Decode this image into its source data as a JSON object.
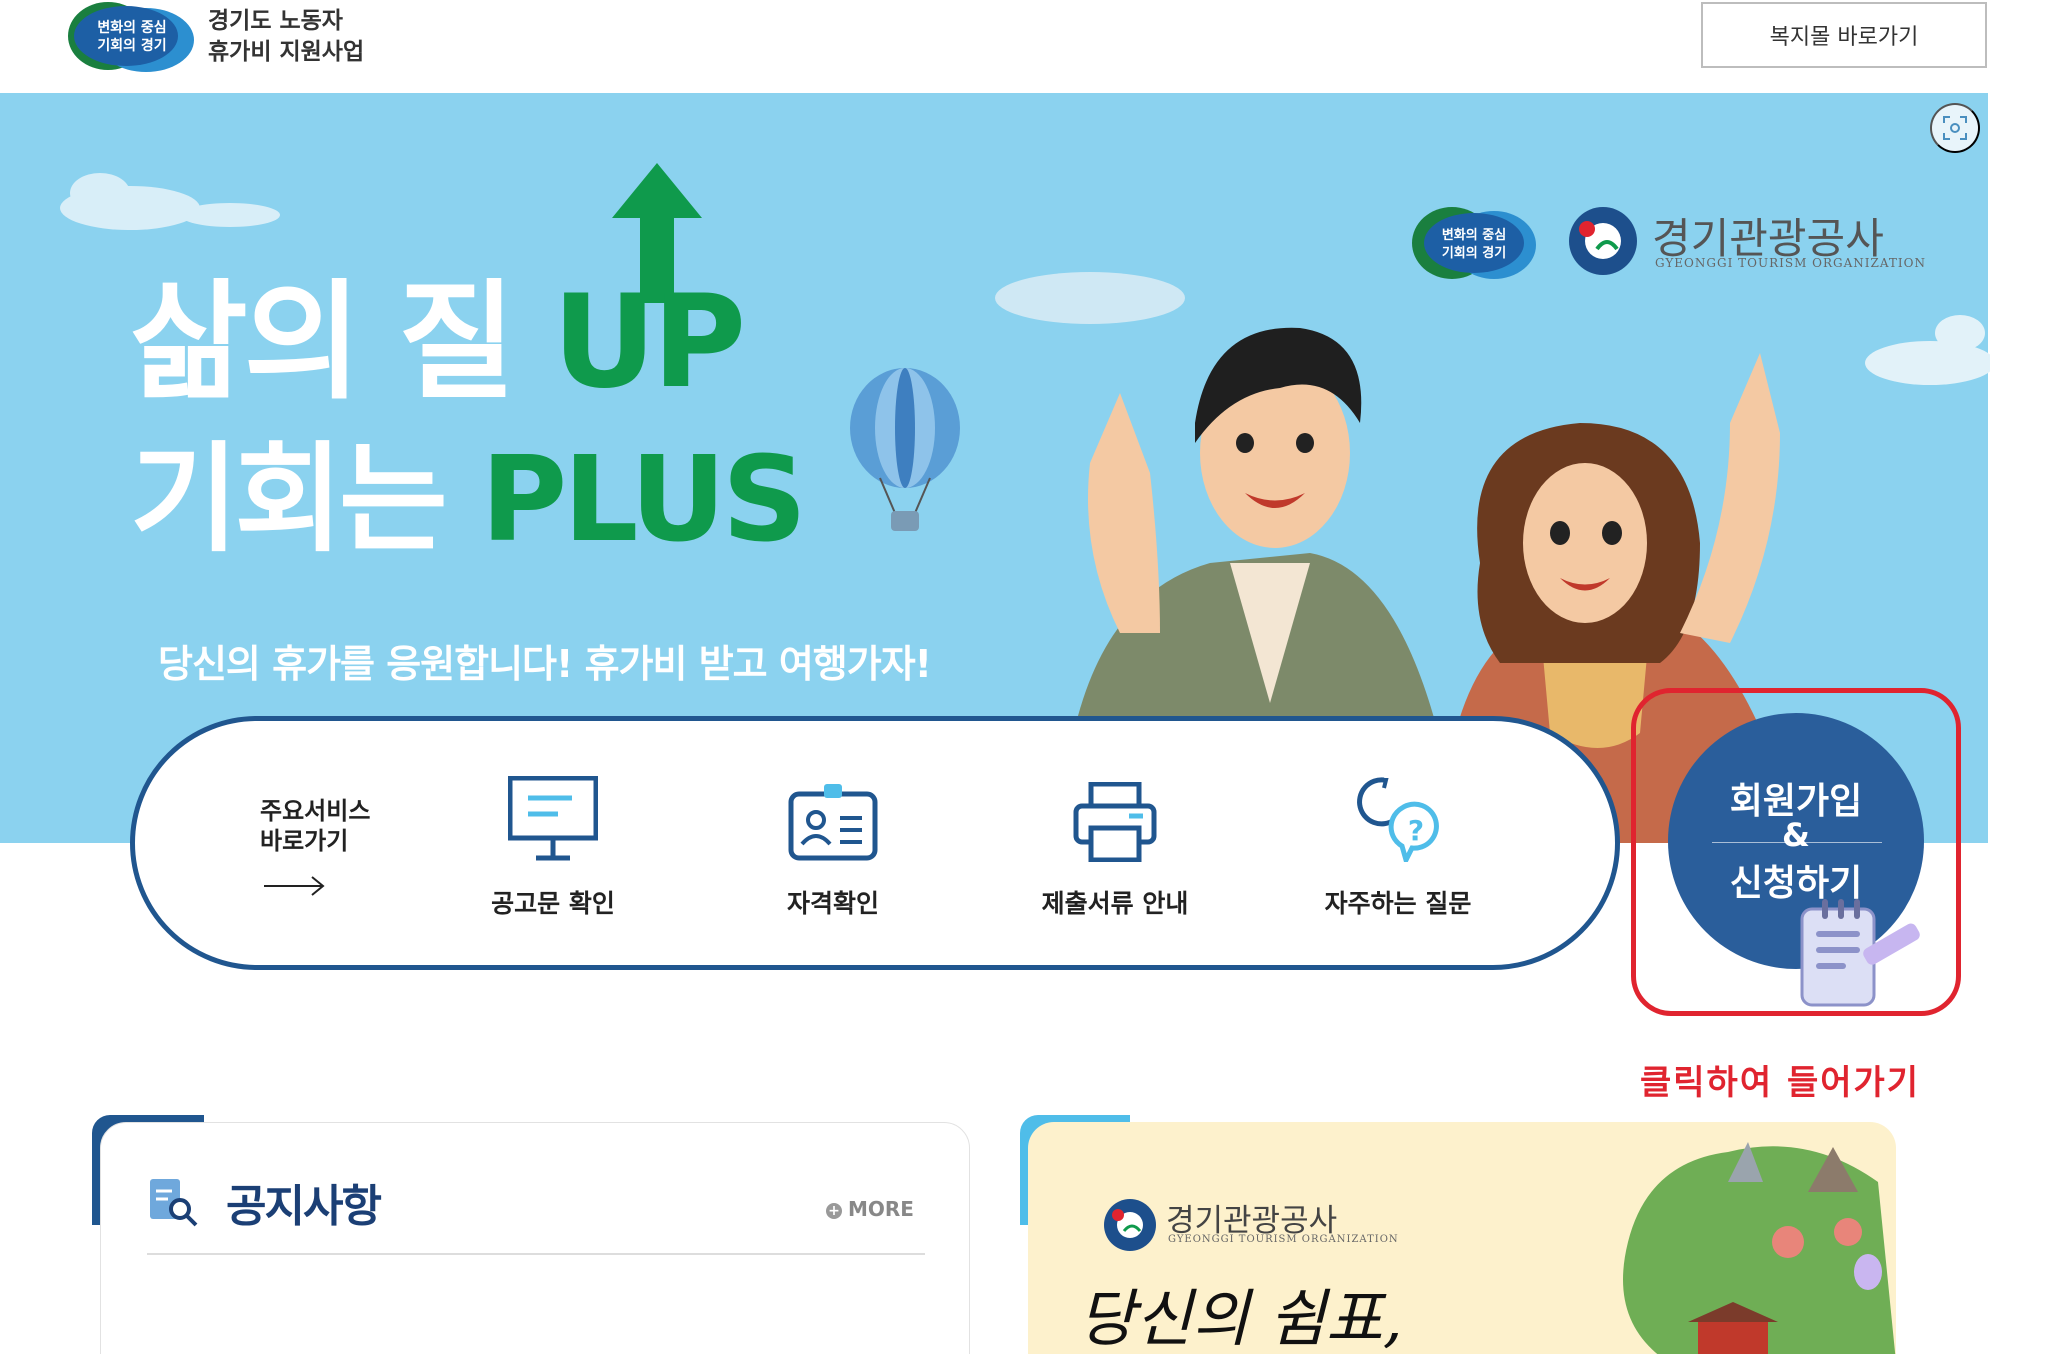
{
  "header": {
    "logo_badge_line1": "변화의 중심",
    "logo_badge_line2": "기회의 경기",
    "title_line1": "경기도 노동자",
    "title_line2": "휴가비 지원사업",
    "mall_button": "복지몰 바로가기"
  },
  "hero": {
    "title_line1_white": "삶의 질 ",
    "title_line1_green": "UP",
    "title_line2_white": "기회는 ",
    "title_line2_green": "PLUS",
    "subtitle": "당신의 휴가를 응원합니다! 휴가비 받고 여행가자!",
    "partner_badge_line1": "변화의 중심",
    "partner_badge_line2": "기회의 경기",
    "org_name": "경기관광공사",
    "org_name_en": "GYEONGGI TOURISM ORGANIZATION"
  },
  "services": {
    "heading_line1": "주요서비스",
    "heading_line2": "바로가기",
    "items": [
      {
        "label": "공고문 확인",
        "icon": "presentation-board-icon"
      },
      {
        "label": "자격확인",
        "icon": "id-card-icon"
      },
      {
        "label": "제출서류 안내",
        "icon": "printer-icon"
      },
      {
        "label": "자주하는 질문",
        "icon": "faq-chat-icon"
      }
    ]
  },
  "join": {
    "line1": "회원가입",
    "amp": "&",
    "line2": "신청하기",
    "hint": "클릭하여 들어가기"
  },
  "notice": {
    "title": "공지사항",
    "more": "MORE"
  },
  "promo": {
    "org_name": "경기관광공사",
    "org_name_en": "GYEONGGI TOURISM ORGANIZATION",
    "script_text": "당신의 쉼표,"
  },
  "colors": {
    "navy": "#20568f",
    "green": "#0f9a4c",
    "sky": "#8bd2ef",
    "red": "#e0242f"
  }
}
